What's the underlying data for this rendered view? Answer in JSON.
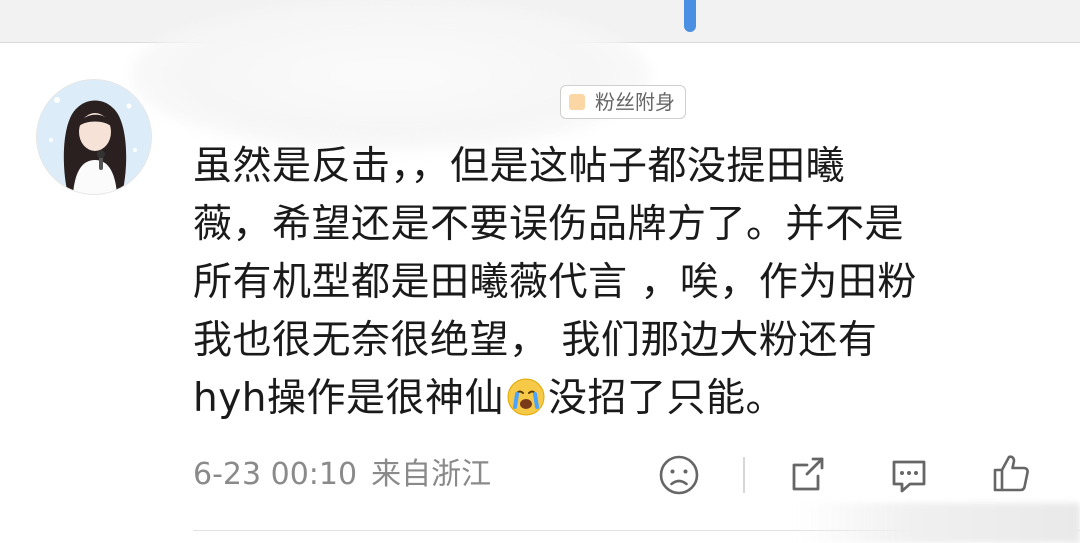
{
  "badge": {
    "label": "粉丝附身"
  },
  "comment": {
    "text_before_emoji": "虽然是反击，，但是这帖子都没提田曦\n薇，希望还是不要误伤品牌方了。并不是\n所有机型都是田曦薇代言 ，唉，作为田粉\n我也很无奈很绝望， 我们那边大粉还有\nhyh操作是很神仙",
    "emoji": "crying-face",
    "text_after_emoji": "没招了只能。"
  },
  "meta": {
    "time": "6-23 00:10",
    "location": "来自浙江"
  },
  "actions": {
    "dislike_icon": "frown-face-icon",
    "share_icon": "share-icon",
    "comment_icon": "comment-icon",
    "like_icon": "thumbs-up-icon"
  },
  "colors": {
    "text": "#1a1a1a",
    "meta": "#8a8a8a",
    "accent_blue": "#4a90e2"
  }
}
